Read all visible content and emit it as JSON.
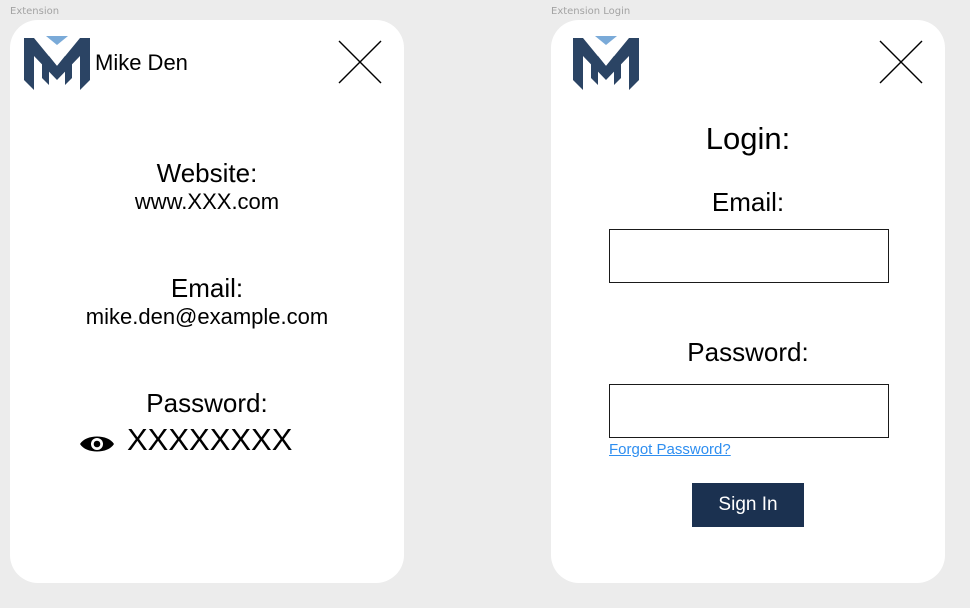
{
  "frames": {
    "extension_label": "Extension",
    "login_label": "Extension Login"
  },
  "extension": {
    "user_name": "Mike Den",
    "website_label": "Website:",
    "website_value": "www.XXX.com",
    "email_label": "Email:",
    "email_value": "mike.den@example.com",
    "password_label": "Password:",
    "password_value": "XXXXXXXX",
    "icons": [
      "logo-icon",
      "close-icon",
      "eye-icon"
    ]
  },
  "login": {
    "title": "Login:",
    "email_label": "Email:",
    "email_value": "",
    "password_label": "Password:",
    "password_value": "",
    "forgot_link": "Forgot Password?",
    "signin_label": "Sign In",
    "icons": [
      "logo-icon",
      "close-icon"
    ]
  },
  "colors": {
    "background": "#ececec",
    "card": "#ffffff",
    "brand_navy": "#1b3150",
    "logo_dark": "#2b4464",
    "logo_light": "#7aaad8",
    "link": "#2e8ef0"
  }
}
